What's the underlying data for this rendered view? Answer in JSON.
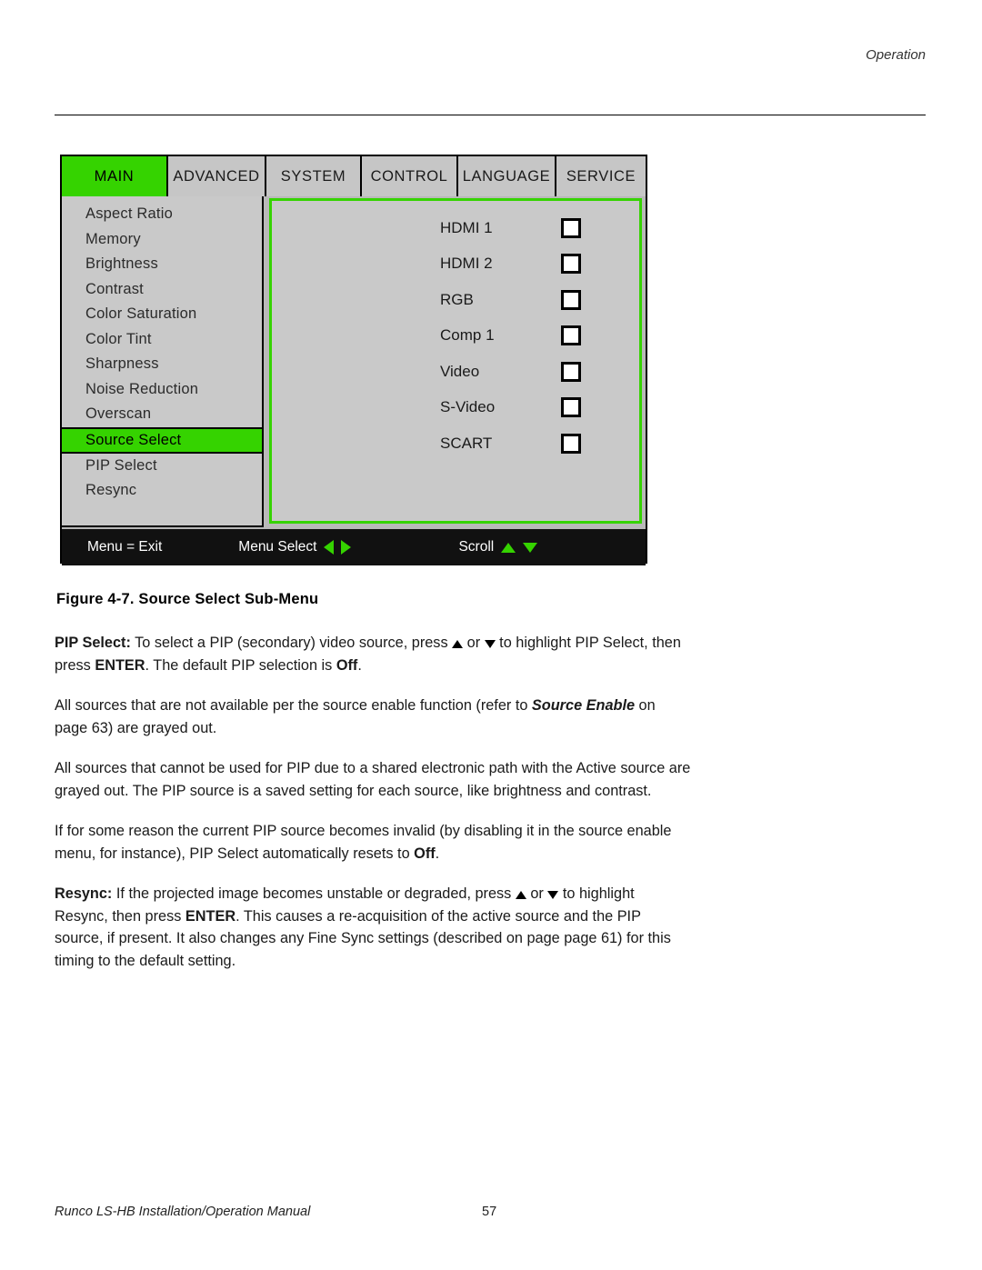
{
  "header": {
    "running_head": "Operation"
  },
  "osd": {
    "tabs": [
      {
        "label": "MAIN",
        "active": true
      },
      {
        "label": "ADVANCED",
        "active": false
      },
      {
        "label": "SYSTEM",
        "active": false
      },
      {
        "label": "CONTROL",
        "active": false
      },
      {
        "label": "LANGUAGE",
        "active": false
      },
      {
        "label": "SERVICE",
        "active": false
      }
    ],
    "menu_items": [
      {
        "label": "Aspect Ratio",
        "selected": false
      },
      {
        "label": "Memory",
        "selected": false
      },
      {
        "label": "Brightness",
        "selected": false
      },
      {
        "label": "Contrast",
        "selected": false
      },
      {
        "label": "Color Saturation",
        "selected": false
      },
      {
        "label": "Color Tint",
        "selected": false
      },
      {
        "label": "Sharpness",
        "selected": false
      },
      {
        "label": "Noise Reduction",
        "selected": false
      },
      {
        "label": "Overscan",
        "selected": false
      },
      {
        "label": "Source Select",
        "selected": true
      },
      {
        "label": "PIP Select",
        "selected": false
      },
      {
        "label": "Resync",
        "selected": false
      }
    ],
    "sources": [
      {
        "label": "HDMI 1",
        "checked": false
      },
      {
        "label": "HDMI 2",
        "checked": false
      },
      {
        "label": "RGB",
        "checked": false
      },
      {
        "label": "Comp 1",
        "checked": false
      },
      {
        "label": "Video",
        "checked": false
      },
      {
        "label": "S-Video",
        "checked": false
      },
      {
        "label": "SCART",
        "checked": false
      }
    ],
    "footer": {
      "exit": "Menu = Exit",
      "select": "Menu Select",
      "scroll": "Scroll"
    },
    "colors": {
      "highlight": "#35d300",
      "panel": "#c9c9c9",
      "footer_bar": "#111111"
    }
  },
  "figure": {
    "caption": "Figure 4-7. Source Select Sub-Menu"
  },
  "body": {
    "p1_label": "PIP Select:",
    "p1_a": " To select a PIP (secondary) video source, press ",
    "p1_b": " or ",
    "p1_c": " to highlight PIP Select, then press ",
    "p1_enter": "ENTER",
    "p1_d": ". The default PIP selection is ",
    "p1_off": "Off",
    "p1_e": ".",
    "p2_a": "All sources that are not available per the source enable function (refer to ",
    "p2_em": "Source Enable",
    "p2_b": " on page 63) are grayed out.",
    "p3": "All sources that cannot be used for PIP due to a shared electronic path with the Active source are grayed out. The PIP source is a saved setting for each source, like brightness and contrast.",
    "p4_a": "If for some reason the current PIP source becomes invalid (by disabling it in the source enable menu, for instance), PIP Select automatically resets to ",
    "p4_off": "Off",
    "p4_b": ".",
    "p5_label": "Resync:",
    "p5_a": " If the projected image becomes unstable or degraded, press ",
    "p5_b": " or ",
    "p5_c": " to highlight Resync, then press ",
    "p5_enter": "ENTER",
    "p5_d": ". This causes a re-acquisition of the active source and the PIP source, if present. It also changes any Fine Sync settings (described on page page 61) for this timing to the default setting."
  },
  "doc_footer": {
    "manual": "Runco LS-HB Installation/Operation Manual",
    "page": "57"
  }
}
